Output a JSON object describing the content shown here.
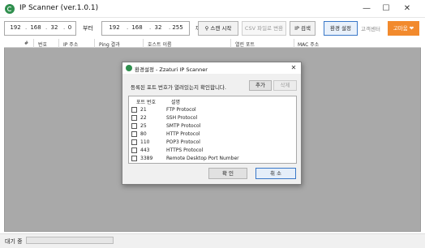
{
  "window": {
    "title": "IP Scanner (ver.1.0.1)",
    "minimize": "—",
    "maximize": "☐",
    "close": "✕"
  },
  "toolbar": {
    "start_ip": [
      "192",
      "168",
      "32",
      "0"
    ],
    "end_ip": [
      "192",
      "168",
      "32",
      "255"
    ],
    "ip_separator": ".",
    "from_label": "부터",
    "to_label": "까지",
    "scan_label": "스캔 시작",
    "scan_icon": "search-icon",
    "export_label": "CSV 파일로 변환",
    "ip_search_label": "IP 검색",
    "settings_label": "환경 설정",
    "support_center_label": "고객센터",
    "support_label": "고마움",
    "support_icon": "heart-icon",
    "support_color": "#f28a2d"
  },
  "table": {
    "columns": [
      "#",
      "번호",
      "IP 주소",
      "Ping 결과",
      "호스트 이름",
      "열린 포트",
      "MAC 주소"
    ]
  },
  "status": {
    "text": "대기 중",
    "progress": 0
  },
  "dialog": {
    "title": "환경설정 - Zzaturi IP Scanner",
    "close": "✕",
    "description": "등록된 포트 번호가 열려있는지 확인합니다.",
    "add_label": "추가",
    "delete_label": "삭제",
    "list_headers": [
      "포트 번호",
      "설명"
    ],
    "ports": [
      {
        "port": "21",
        "desc": "FTP Protocol",
        "checked": false
      },
      {
        "port": "22",
        "desc": "SSH Protocol",
        "checked": false
      },
      {
        "port": "25",
        "desc": "SMTP Protocol",
        "checked": false
      },
      {
        "port": "80",
        "desc": "HTTP Protocol",
        "checked": false
      },
      {
        "port": "110",
        "desc": "POP3 Protocol",
        "checked": false
      },
      {
        "port": "443",
        "desc": "HTTPS Protocol",
        "checked": false
      },
      {
        "port": "3389",
        "desc": "Remote Desktop Port Number",
        "checked": false
      }
    ],
    "ok_label": "확 인",
    "cancel_label": "취 소"
  }
}
